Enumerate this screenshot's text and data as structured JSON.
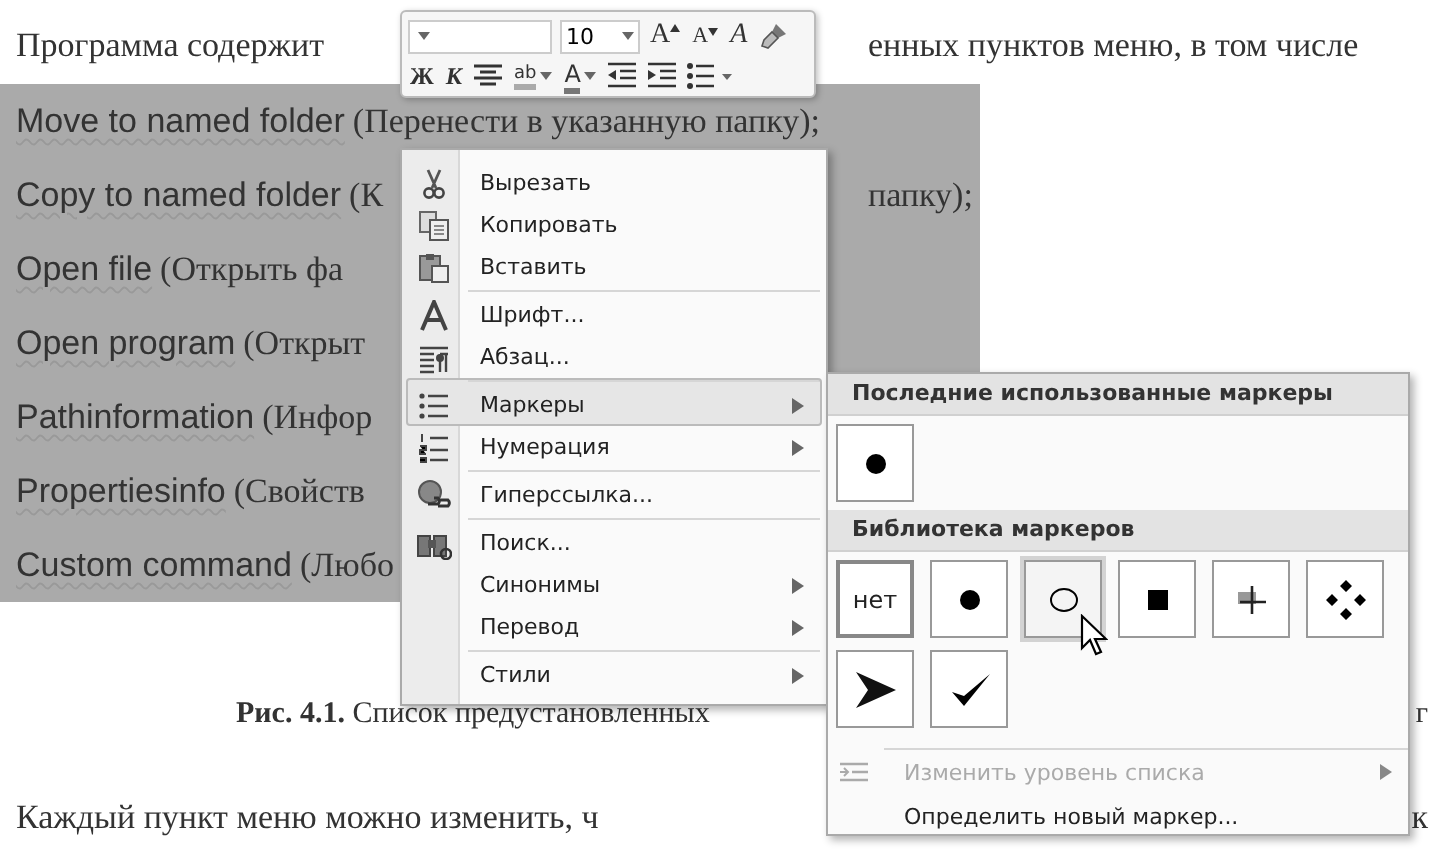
{
  "document": {
    "lines": [
      {
        "selected": false,
        "parts": [
          {
            "kind": "serif",
            "text": "Программа содержит"
          }
        ],
        "right": "енных  пунктов  меню,  в том числе"
      },
      {
        "selected": true,
        "parts": [
          {
            "kind": "sans",
            "text": "Move to named folder"
          },
          {
            "kind": "serif",
            "text": "(Перенести в указанную  папку);"
          }
        ]
      },
      {
        "selected": true,
        "parts": [
          {
            "kind": "sans",
            "text": "Copy to named folder"
          },
          {
            "kind": "serif",
            "text": "(К"
          }
        ],
        "right": "папку);"
      },
      {
        "selected": true,
        "parts": [
          {
            "kind": "sans",
            "text": "Open file"
          },
          {
            "kind": "serif",
            "text": "(Открыть фа"
          }
        ]
      },
      {
        "selected": true,
        "parts": [
          {
            "kind": "sans",
            "text": "Open program"
          },
          {
            "kind": "serif",
            "text": "(Открыт"
          }
        ]
      },
      {
        "selected": true,
        "parts": [
          {
            "kind": "sans",
            "text": "Pathinformation"
          },
          {
            "kind": "serif",
            "text": "(Инфор"
          }
        ]
      },
      {
        "selected": true,
        "parts": [
          {
            "kind": "sans",
            "text": "Propertiesinfo"
          },
          {
            "kind": "serif",
            "text": "(Свойств"
          }
        ]
      },
      {
        "selected": true,
        "parts": [
          {
            "kind": "sans",
            "text": "Custom command"
          },
          {
            "kind": "serif",
            "text": "(Любо"
          }
        ]
      }
    ],
    "caption": {
      "text": "**Рис. 4.1.** Список предустановленных",
      "right": "г"
    },
    "body": {
      "text": "Каждый  пункт  меню  можно  изменить,  ч",
      "right": "к"
    }
  },
  "mini_toolbar": {
    "font_size": "10",
    "row1": [
      {
        "kind": "grow",
        "label": "A"
      },
      {
        "kind": "shrink",
        "label": "A"
      },
      {
        "kind": "styles",
        "label": "A"
      },
      {
        "kind": "brush"
      }
    ],
    "row2": [
      {
        "kind": "bold",
        "label": "Ж"
      },
      {
        "kind": "italic",
        "label": "К"
      },
      {
        "kind": "center"
      },
      {
        "kind": "highlight",
        "label": "ab"
      },
      {
        "kind": "fontcolor",
        "label": "A"
      },
      {
        "kind": "outdent"
      },
      {
        "kind": "indent"
      },
      {
        "kind": "bullets"
      }
    ]
  },
  "context_menu": [
    {
      "kind": "cut",
      "label": "Вырезать",
      "separator_above": false,
      "has_submenu": false,
      "selected": false
    },
    {
      "kind": "copy",
      "label": "Копировать",
      "separator_above": false,
      "has_submenu": false,
      "selected": false
    },
    {
      "kind": "paste",
      "label": "Вставить",
      "separator_above": false,
      "has_submenu": false,
      "selected": false
    },
    {
      "kind": "font",
      "label": "Шрифт...",
      "separator_above": true,
      "has_submenu": false,
      "selected": false
    },
    {
      "kind": "paragraph",
      "label": "Абзац...",
      "separator_above": false,
      "has_submenu": false,
      "selected": false
    },
    {
      "kind": "bullets",
      "label": "Маркеры",
      "separator_above": true,
      "has_submenu": true,
      "selected": true
    },
    {
      "kind": "numbering",
      "label": "Нумерация",
      "separator_above": false,
      "has_submenu": true,
      "selected": false
    },
    {
      "kind": "hyperlink",
      "label": "Гиперссылка...",
      "separator_above": true,
      "has_submenu": false,
      "selected": false
    },
    {
      "kind": "search",
      "label": "Поиск...",
      "separator_above": true,
      "has_submenu": false,
      "selected": false
    },
    {
      "kind": "plain",
      "label": "Синонимы",
      "separator_above": false,
      "has_submenu": true,
      "selected": false
    },
    {
      "kind": "plain",
      "label": "Перевод",
      "separator_above": false,
      "has_submenu": true,
      "selected": false
    },
    {
      "kind": "plain",
      "label": "Стили",
      "separator_above": true,
      "has_submenu": true,
      "selected": false
    }
  ],
  "bullets_submenu": {
    "recent_title": "Последние использованные маркеры",
    "recent": [
      {
        "kind": "disc"
      }
    ],
    "library_title": "Библиотека маркеров",
    "library": [
      {
        "kind": "none",
        "label": "нет",
        "selected": true,
        "hovered": false
      },
      {
        "kind": "disc",
        "selected": false,
        "hovered": false
      },
      {
        "kind": "circle",
        "selected": false,
        "hovered": true
      },
      {
        "kind": "square",
        "selected": false,
        "hovered": false
      },
      {
        "kind": "cross",
        "selected": false,
        "hovered": false
      },
      {
        "kind": "diamonds",
        "selected": false,
        "hovered": false
      },
      {
        "kind": "arrowhead",
        "selected": false,
        "hovered": false
      },
      {
        "kind": "check",
        "selected": false,
        "hovered": false
      }
    ],
    "actions": [
      {
        "label": "Изменить уровень списка",
        "disabled": true,
        "has_submenu": true
      },
      {
        "label": "Определить новый маркер...",
        "disabled": false,
        "has_submenu": false
      }
    ]
  }
}
